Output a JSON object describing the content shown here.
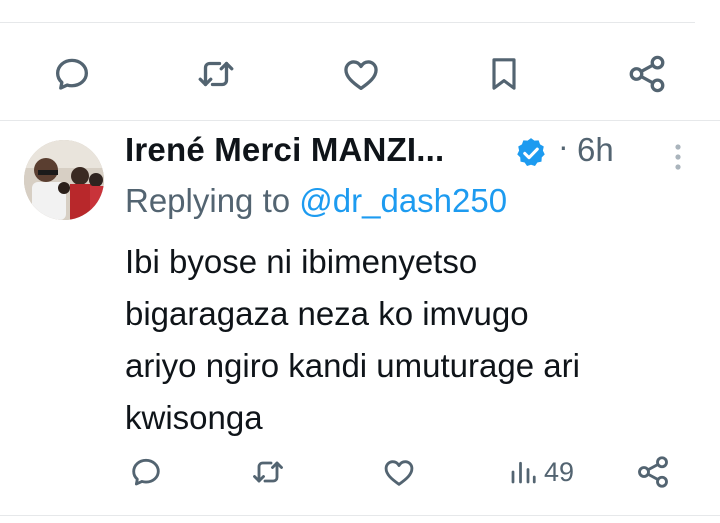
{
  "top_actions": {
    "reply": {
      "icon": "reply-icon"
    },
    "retweet": {
      "icon": "retweet-icon"
    },
    "like": {
      "icon": "heart-icon"
    },
    "bookmark": {
      "icon": "bookmark-icon"
    },
    "share": {
      "icon": "share-icon"
    }
  },
  "reply_tweet": {
    "author_name": "Irené Merci MANZI...",
    "verified": true,
    "separator": "·",
    "time": "6h",
    "replying_prefix": "Replying to ",
    "replying_handle": "@dr_dash250",
    "text_lines": [
      "Ibi byose ni ibimenyetso",
      "bigaragaza neza ko imvugo",
      "ariyo ngiro kandi umuturage ari",
      "kwisonga"
    ],
    "actions": {
      "views": "49"
    }
  },
  "colors": {
    "icon_gray": "#536471",
    "text": "#0f1419",
    "link_blue": "#1d9bf0",
    "verified_blue": "#1d9bf0",
    "divider": "#e6e8ea"
  }
}
